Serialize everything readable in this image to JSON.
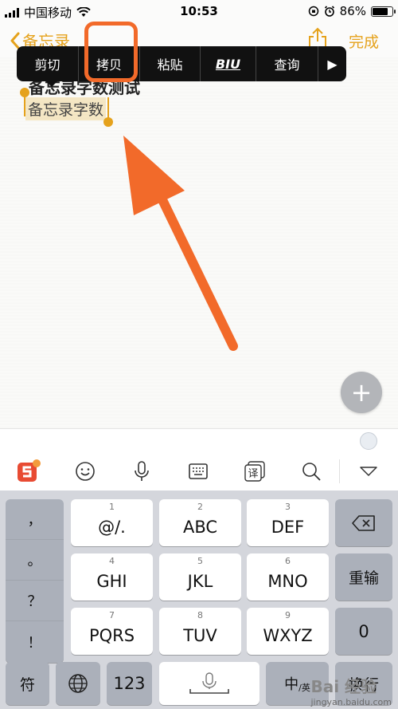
{
  "status": {
    "carrier": "中国移动",
    "time": "10:53",
    "battery": "86%",
    "battery_level": 0.86
  },
  "nav": {
    "back_label": "备忘录",
    "done_label": "完成"
  },
  "note": {
    "title": "备忘录字数测试",
    "body": "备忘录字数"
  },
  "edit_menu": {
    "items": [
      "剪切",
      "拷贝",
      "粘贴",
      "BIU",
      "查询"
    ],
    "more": "▶"
  },
  "fab_label": "+",
  "ime_toolbar": {
    "icons": [
      "sogou-logo-icon",
      "emoji-icon",
      "microphone-icon",
      "keyboard-icon",
      "translate-icon",
      "search-icon",
      "collapse-icon"
    ],
    "translate_glyph": "译"
  },
  "keyboard": {
    "punctuation": [
      "，",
      "。",
      "？",
      "！"
    ],
    "keys_row1": [
      {
        "num": "1",
        "label": "@/."
      },
      {
        "num": "2",
        "label": "ABC"
      },
      {
        "num": "3",
        "label": "DEF"
      }
    ],
    "keys_row2": [
      {
        "num": "4",
        "label": "GHI"
      },
      {
        "num": "5",
        "label": "JKL"
      },
      {
        "num": "6",
        "label": "MNO"
      }
    ],
    "keys_row3": [
      {
        "num": "7",
        "label": "PQRS"
      },
      {
        "num": "8",
        "label": "TUV"
      },
      {
        "num": "9",
        "label": "WXYZ"
      }
    ],
    "retype": "重输",
    "zero": "0",
    "symbol": "符",
    "num_switch": "123",
    "lang_switch_main": "中",
    "lang_switch_sub": "/英",
    "enter": "换行"
  },
  "watermark": {
    "brand": "Bai 经验",
    "url": "jingyan.baidu.com"
  },
  "colors": {
    "accent": "#e5a21c",
    "annotation": "#f26a2a",
    "menu_bg": "#111111"
  }
}
